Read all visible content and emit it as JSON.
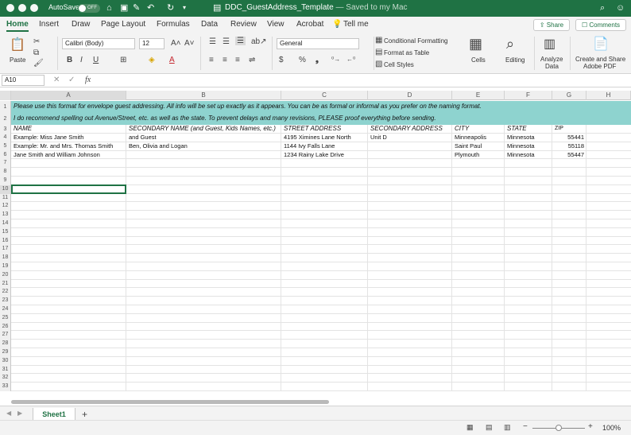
{
  "titlebar": {
    "autosave": "AutoSave",
    "toggle": "OFF",
    "doc": "DDC_GuestAddress_Template",
    "saved": " — Saved to my Mac"
  },
  "tabs": [
    "Home",
    "Insert",
    "Draw",
    "Page Layout",
    "Formulas",
    "Data",
    "Review",
    "View",
    "Acrobat",
    "Tell me"
  ],
  "ribbon": {
    "share": "Share",
    "comments": "Comments",
    "paste": "Paste",
    "font": "Calibri (Body)",
    "size": "12",
    "number_format": "General",
    "conditional": "Conditional Formatting",
    "format_table": "Format as Table",
    "cell_styles": "Cell Styles",
    "cells": "Cells",
    "editing": "Editing",
    "analyze_1": "Analyze",
    "analyze_2": "Data",
    "create_1": "Create and Share",
    "create_2": "Adobe PDF",
    "bold": "B",
    "italic": "I",
    "underline": "U",
    "currency": "$",
    "percent": "%"
  },
  "formula": {
    "namebox": "A10",
    "fx": "fx"
  },
  "columns": [
    "A",
    "B",
    "C",
    "D",
    "E",
    "F",
    "G",
    "H"
  ],
  "notice": [
    "Please use this format for envelope guest addressing. All info will be set up exactly as it appears. You can be as formal or informal as you prefer on the naming format.",
    "I do recommend spelling out Avenue/Street, etc. as well as the state. To prevent delays and many revisions, PLEASE proof everything before sending."
  ],
  "headers": [
    "NAME",
    "SECONDARY NAME (and Guest, Kids Names, etc.)",
    "STREET ADDRESS",
    "SECONDARY ADDRESS",
    "CITY",
    "STATE",
    "ZIP"
  ],
  "rows": [
    [
      "Example: Miss Jane Smith",
      "and Guest",
      "4195 Ximines Lane North",
      "Unit D",
      "Minneapolis",
      "Minnesota",
      "55441"
    ],
    [
      "Example: Mr. and Mrs. Thomas Smith",
      "Ben, Olivia and Logan",
      "1144 Ivy Falls Lane",
      "",
      "Saint Paul",
      "Minnesota",
      "55118"
    ],
    [
      "Jane Smith and William Johnson",
      "",
      "1234 Rainy Lake Drive",
      "",
      "Plymouth",
      "Minnesota",
      "55447"
    ]
  ],
  "row_numbers": [
    "1",
    "2",
    "3",
    "4",
    "5",
    "6",
    "7",
    "8",
    "9",
    "10",
    "11",
    "12",
    "13",
    "14",
    "15",
    "16",
    "17",
    "18",
    "19",
    "20",
    "21",
    "22",
    "23",
    "24",
    "25",
    "26",
    "27",
    "28",
    "29",
    "30",
    "31",
    "32",
    "33"
  ],
  "sheet_tab": "Sheet1",
  "zoom": "100%"
}
